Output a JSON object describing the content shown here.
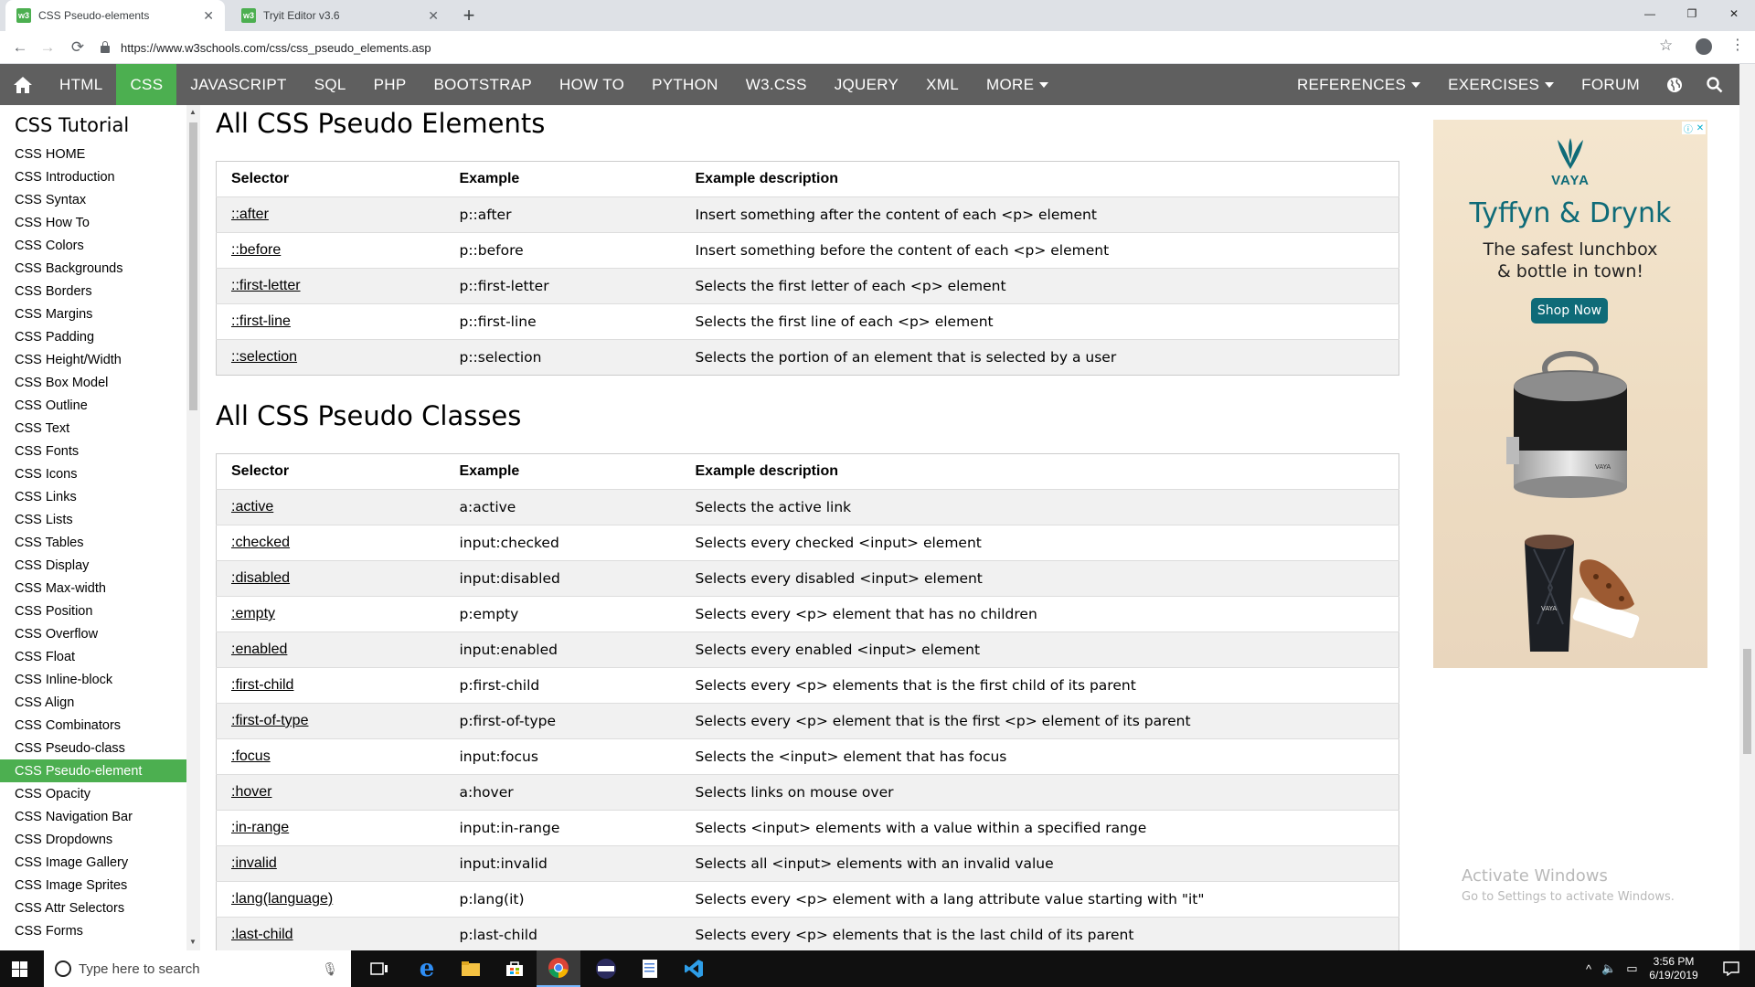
{
  "browser": {
    "tabs": [
      {
        "title": "CSS Pseudo-elements",
        "icon": "w3"
      },
      {
        "title": "Tryit Editor v3.6",
        "icon": "w3"
      }
    ],
    "url": "https://www.w3schools.com/css/css_pseudo_elements.asp"
  },
  "topnav": {
    "items": [
      "HTML",
      "CSS",
      "JAVASCRIPT",
      "SQL",
      "PHP",
      "BOOTSTRAP",
      "HOW TO",
      "PYTHON",
      "W3.CSS",
      "JQUERY",
      "XML",
      "MORE"
    ],
    "active": "CSS",
    "right": [
      "REFERENCES",
      "EXERCISES",
      "FORUM"
    ]
  },
  "sidebar": {
    "title": "CSS Tutorial",
    "items": [
      "CSS HOME",
      "CSS Introduction",
      "CSS Syntax",
      "CSS How To",
      "CSS Colors",
      "CSS Backgrounds",
      "CSS Borders",
      "CSS Margins",
      "CSS Padding",
      "CSS Height/Width",
      "CSS Box Model",
      "CSS Outline",
      "CSS Text",
      "CSS Fonts",
      "CSS Icons",
      "CSS Links",
      "CSS Lists",
      "CSS Tables",
      "CSS Display",
      "CSS Max-width",
      "CSS Position",
      "CSS Overflow",
      "CSS Float",
      "CSS Inline-block",
      "CSS Align",
      "CSS Combinators",
      "CSS Pseudo-class",
      "CSS Pseudo-element",
      "CSS Opacity",
      "CSS Navigation Bar",
      "CSS Dropdowns",
      "CSS Image Gallery",
      "CSS Image Sprites",
      "CSS Attr Selectors",
      "CSS Forms"
    ],
    "current": "CSS Pseudo-element"
  },
  "main": {
    "elements_heading": "All CSS Pseudo Elements",
    "classes_heading": "All CSS Pseudo Classes",
    "headers": [
      "Selector",
      "Example",
      "Example description"
    ],
    "pseudo_elements": [
      [
        "::after",
        "p::after",
        "Insert something after the content of each <p> element"
      ],
      [
        "::before",
        "p::before",
        "Insert something before the content of each <p> element"
      ],
      [
        "::first-letter",
        "p::first-letter",
        "Selects the first letter of each <p> element"
      ],
      [
        "::first-line",
        "p::first-line",
        "Selects the first line of each <p> element"
      ],
      [
        "::selection",
        "p::selection",
        "Selects the portion of an element that is selected by a user"
      ]
    ],
    "pseudo_classes": [
      [
        ":active",
        "a:active",
        "Selects the active link"
      ],
      [
        ":checked",
        "input:checked",
        "Selects every checked <input> element"
      ],
      [
        ":disabled",
        "input:disabled",
        "Selects every disabled <input> element"
      ],
      [
        ":empty",
        "p:empty",
        "Selects every <p> element that has no children"
      ],
      [
        ":enabled",
        "input:enabled",
        "Selects every enabled <input> element"
      ],
      [
        ":first-child",
        "p:first-child",
        "Selects every <p> elements that is the first child of its parent"
      ],
      [
        ":first-of-type",
        "p:first-of-type",
        "Selects every <p> element that is the first <p> element of its parent"
      ],
      [
        ":focus",
        "input:focus",
        "Selects the <input> element that has focus"
      ],
      [
        ":hover",
        "a:hover",
        "Selects links on mouse over"
      ],
      [
        ":in-range",
        "input:in-range",
        "Selects <input> elements with a value within a specified range"
      ],
      [
        ":invalid",
        "input:invalid",
        "Selects all <input> elements with an invalid value"
      ],
      [
        ":lang(language)",
        "p:lang(it)",
        "Selects every <p> element with a lang attribute value starting with \"it\""
      ],
      [
        ":last-child",
        "p:last-child",
        "Selects every <p> elements that is the last child of its parent"
      ]
    ]
  },
  "ad": {
    "brand": "VAYA",
    "headline": "Tyffyn & Drynk",
    "subline1": "The safest lunchbox",
    "subline2": "& bottle in town!",
    "cta": "Shop Now",
    "product_brand": "VAYA"
  },
  "watermark": {
    "line1": "Activate Windows",
    "line2": "Go to Settings to activate Windows."
  },
  "taskbar": {
    "search_placeholder": "Type here to search",
    "time": "3:56 PM",
    "date": "6/19/2019"
  },
  "colors": {
    "accent": "#4caf50",
    "topnav": "#5f5f5f",
    "ad_teal": "#0f6b78"
  }
}
